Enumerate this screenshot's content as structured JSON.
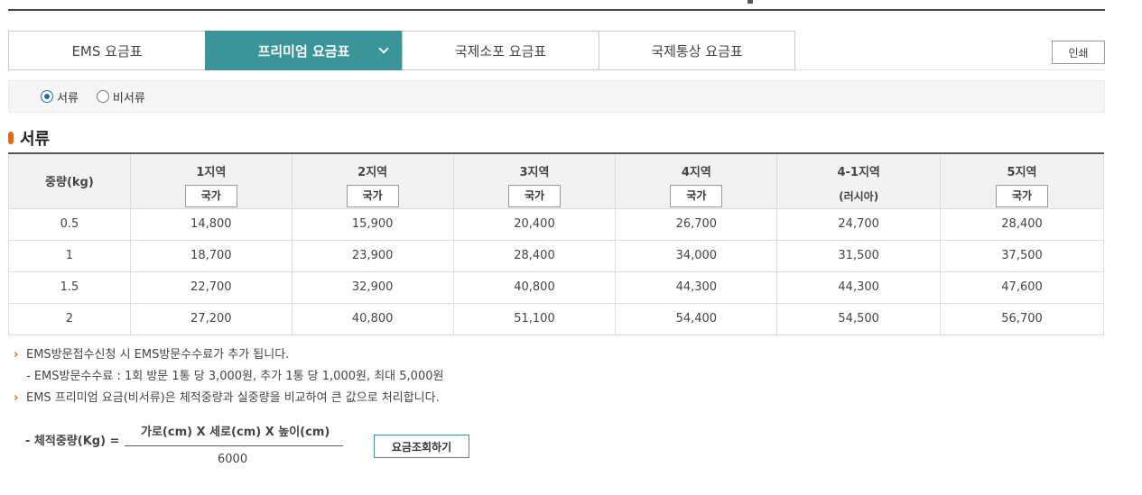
{
  "tabs": [
    {
      "label": "EMS 요금표",
      "active": false
    },
    {
      "label": "프리미엄 요금표",
      "active": true
    },
    {
      "label": "국제소포 요금표",
      "active": false
    },
    {
      "label": "국제통상 요금표",
      "active": false
    }
  ],
  "print_label": "인쇄",
  "radios": [
    {
      "label": "서류",
      "checked": true
    },
    {
      "label": "비서류",
      "checked": false
    }
  ],
  "section_title": "서류",
  "table": {
    "weight_header": "중량(kg)",
    "zones": [
      {
        "name": "1지역",
        "button": "국가"
      },
      {
        "name": "2지역",
        "button": "국가"
      },
      {
        "name": "3지역",
        "button": "국가"
      },
      {
        "name": "4지역",
        "button": "국가"
      },
      {
        "name": "4-1지역",
        "note": "(러시아)"
      },
      {
        "name": "5지역",
        "button": "국가"
      }
    ],
    "rows": [
      {
        "weight": "0.5",
        "prices": [
          "14,800",
          "15,900",
          "20,400",
          "26,700",
          "24,700",
          "28,400"
        ]
      },
      {
        "weight": "1",
        "prices": [
          "18,700",
          "23,900",
          "28,400",
          "34,000",
          "31,500",
          "37,500"
        ]
      },
      {
        "weight": "1.5",
        "prices": [
          "22,700",
          "32,900",
          "40,800",
          "44,300",
          "44,300",
          "47,600"
        ]
      },
      {
        "weight": "2",
        "prices": [
          "27,200",
          "40,800",
          "51,100",
          "54,400",
          "54,500",
          "56,700"
        ]
      }
    ]
  },
  "notes": {
    "note1": "EMS방문접수신청 시 EMS방문수수료가 추가 됩니다.",
    "note1_sub": "- EMS방문수수료 : 1회 방문 1통 당 3,000원, 추가 1통 당 1,000원, 최대 5,000원",
    "note2": "EMS 프리미엄 요금(비서류)은 체적중량과 실중량을 비교하여 큰 값으로 처리합니다.",
    "arrow": "›"
  },
  "formula": {
    "label": "- 체적중량(Kg) =",
    "numerator": "가로(cm) X 세로(cm) X 높이(cm)",
    "denominator": "6000"
  },
  "calc_button": "요금조회하기",
  "colors": {
    "accent": "#3a9599",
    "highlight": "#e8680f"
  }
}
